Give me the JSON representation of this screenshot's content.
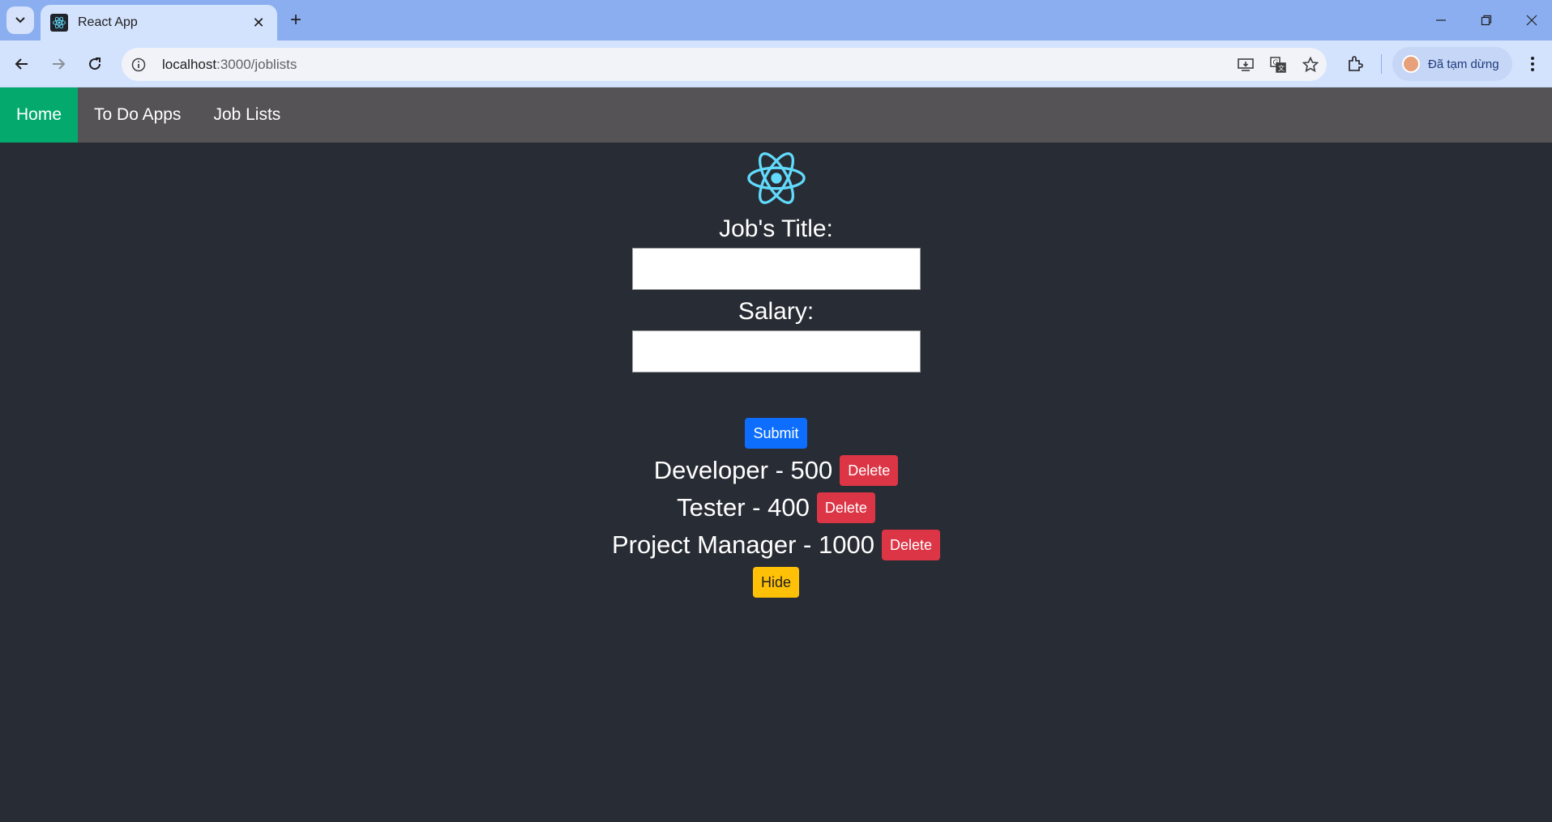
{
  "browser": {
    "tab_title": "React App",
    "url_host": "localhost",
    "url_path": ":3000/joblists",
    "profile_label": "Đã tạm dừng"
  },
  "navbar": {
    "items": [
      {
        "label": "Home",
        "active": true
      },
      {
        "label": "To Do Apps",
        "active": false
      },
      {
        "label": "Job Lists",
        "active": false
      }
    ]
  },
  "form": {
    "title_label": "Job's Title:",
    "title_value": "",
    "salary_label": "Salary:",
    "salary_value": "",
    "submit_label": "Submit"
  },
  "jobs": [
    {
      "text": "Developer - 500",
      "delete_label": "Delete"
    },
    {
      "text": "Tester - 400",
      "delete_label": "Delete"
    },
    {
      "text": "Project Manager - 1000",
      "delete_label": "Delete"
    }
  ],
  "hide_label": "Hide",
  "colors": {
    "page_bg": "#282c34",
    "navbar_bg": "#555355",
    "nav_active": "#04aa6d",
    "submit": "#0d6efd",
    "delete": "#dc3545",
    "hide": "#ffc107",
    "react_logo": "#61dafb"
  },
  "icons": [
    "tab-search-icon",
    "react-favicon-icon",
    "close-icon",
    "plus-icon",
    "minimize-icon",
    "restore-icon",
    "back-icon",
    "forward-icon",
    "reload-icon",
    "site-info-icon",
    "install-app-icon",
    "translate-icon",
    "bookmark-star-icon",
    "extensions-icon",
    "menu-dots-icon",
    "react-logo-icon"
  ]
}
